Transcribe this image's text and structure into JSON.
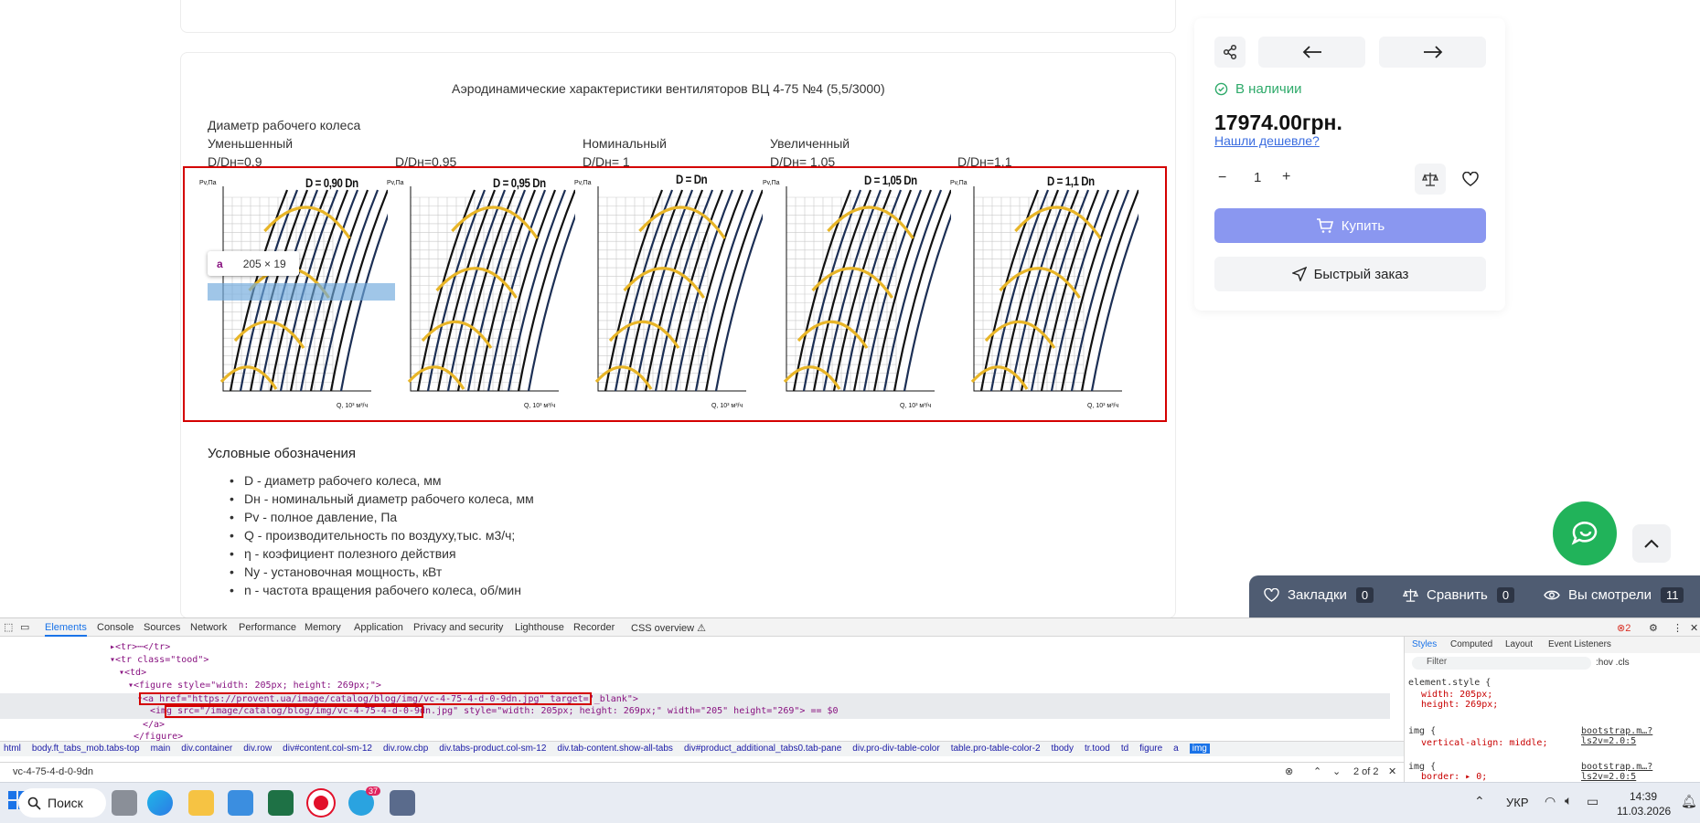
{
  "page": {
    "chart_heading": "Аэродинамические характеристики вентиляторов ВЦ 4-75 №4 (5,5/3000)",
    "diameter_title": "Диаметр рабочего колеса",
    "columns": [
      {
        "label": "Уменьшенный",
        "ratio": "D/Dн=0,9"
      },
      {
        "label": "",
        "ratio": "D/Dн=0,95"
      },
      {
        "label": "Номинальный",
        "ratio": "D/Dн= 1"
      },
      {
        "label": "Увеличенный",
        "ratio": "D/Dн= 1,05"
      },
      {
        "label": "",
        "ratio": "D/Dн=1,1"
      }
    ],
    "charts": [
      {
        "title": "D = 0,90 Dn",
        "ylabel": "Pv,Па",
        "xlabel": "Q, 10³ м³/ч"
      },
      {
        "title": "D = 0,95 Dn",
        "ylabel": "Pv,Па",
        "xlabel": "Q, 10³ м³/ч"
      },
      {
        "title": "D = Dn",
        "ylabel": "Pv,Па",
        "xlabel": "Q, 10³ м³/ч"
      },
      {
        "title": "D = 1,05 Dn",
        "ylabel": "Pv,Па",
        "xlabel": "Q, 10³ м³/ч"
      },
      {
        "title": "D = 1,1 Dn",
        "ylabel": "Pv,Па",
        "xlabel": "Q, 10³ м³/ч"
      }
    ],
    "tooltip": {
      "tag": "a",
      "size": "205 × 19"
    },
    "legend_title": "Условные обозначения",
    "legend_items": [
      "D - диаметр рабочего колеса, мм",
      "Dн - номинальный диаметр рабочего колеса, мм",
      "Pv - полное давление, Па",
      "Q - производительность по воздуху,тыс. м3/ч;",
      "η - коэфициент полезного действия",
      "Ny - установочная мощность, кВт",
      "n - частота вращения рабочего колеса, об/мин"
    ]
  },
  "product": {
    "stock": "В наличии",
    "price": "17974.00грн.",
    "cheaper_link": "Нашли дешевле?",
    "quantity": "1",
    "buy_label": "Купить",
    "quick_order": "Быстрый заказ",
    "accent": "#8a97f0",
    "stock_color": "#2eaa6a"
  },
  "bottom_bar": {
    "bookmarks": "Закладки",
    "bookmarks_count": "0",
    "compare": "Сравнить",
    "compare_count": "0",
    "viewed": "Вы смотрели",
    "viewed_count": "11"
  },
  "devtools": {
    "tabs": [
      "Elements",
      "Console",
      "Sources",
      "Network",
      "Performance",
      "Memory",
      "Application",
      "Privacy and security",
      "Lighthouse",
      "Recorder",
      "CSS overview ⚠"
    ],
    "error_count": "2",
    "lines": [
      "▸<tr>⋯</tr>",
      "▾<tr class=\"tood\">",
      "▾<td>",
      "▾<figure style=\"width: 205px; height: 269px;\">",
      "▾<a href=\"https://provent.ua/image/catalog/blog/img/vc-4-75-4-d-0-9dn.jpg\" target=\"_blank\">",
      "<img src=\"/image/catalog/blog/img/vc-4-75-4-d-0-9dn.jpg\" style=\"width: 205px; height: 269px;\" width=\"205\" height=\"269\"> == $0",
      "</a>",
      "</figure>"
    ],
    "breadcrumbs": [
      "html",
      "body.ft_tabs_mob.tabs-top",
      "main",
      "div.container",
      "div.row",
      "div#content.col-sm-12",
      "div.row.cbp",
      "div.tabs-product.col-sm-12",
      "div.tab-content.show-all-tabs",
      "div#product_additional_tabs0.tab-pane",
      "div.pro-div-table-color",
      "table.pro-table-color-2",
      "tbody",
      "tr.tood",
      "td",
      "figure",
      "a",
      "img"
    ],
    "search_value": "vc-4-75-4-d-0-9dn",
    "search_count": "2 of 2",
    "styles_tabs": [
      "Styles",
      "Computed",
      "Layout",
      "Event Listeners"
    ],
    "filter_placeholder": "Filter",
    "hov_cls": ":hov .cls",
    "rules": [
      {
        "selector": "element.style {",
        "props": [
          "width: 205px;",
          "height: 269px;"
        ],
        "source": ""
      },
      {
        "selector": "img {",
        "props": [
          "vertical-align: middle;"
        ],
        "source": "bootstrap.m…?ls2v=2.0:5"
      },
      {
        "selector": "img {",
        "props": [
          "border: ▸ 0;"
        ],
        "source": "bootstrap.m…?ls2v=2.0:5"
      }
    ]
  },
  "taskbar": {
    "search_label": "Поиск",
    "language": "УКР",
    "time": "14:39",
    "date": "11.03.2026",
    "telegram_badge": "37"
  }
}
